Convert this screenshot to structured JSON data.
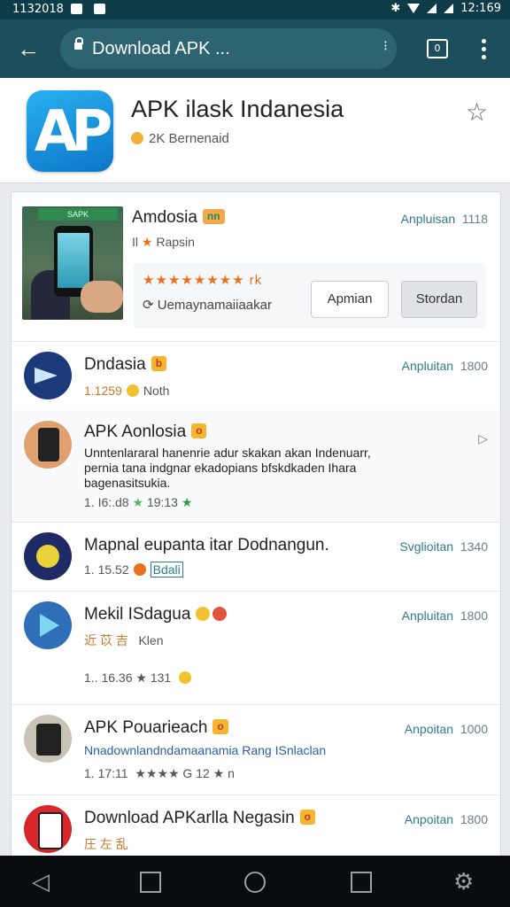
{
  "status_bar": {
    "time_left": "1132018",
    "time_right": "12:169"
  },
  "browser": {
    "url_text": "Download APK ...",
    "url_more": "⁝",
    "tab_count": "0"
  },
  "header": {
    "title": "APK ilask Indanesia",
    "subtitle": "2K Bernenaid",
    "logo_text": "AP"
  },
  "featured": {
    "banner": "SAPK",
    "name": "Amdosia",
    "badge": "nn",
    "action": "Anpluisan",
    "size": "1118",
    "meta_prefix": "Il",
    "meta": "Rapsin",
    "stars": "★★★★★★★★ rk",
    "promo": "Uemaynamaiiaakar",
    "button_primary": "Apmian",
    "button_secondary": "Stordan"
  },
  "list": [
    {
      "name": "Dndasia",
      "badge": "b",
      "action": "Anpluitan",
      "size": "1800",
      "meta_num": "1.1259",
      "meta_tag": "Noth"
    },
    {
      "name": "APK Aonlosia",
      "badge": "o",
      "desc": "Unntenlararal hanenrie adur skakan akan Indenuarr, pernia tana indgnar ekadopians bfskdkaden Ihara bagenasitsukia.",
      "meta_num": "1. I6:.d8",
      "meta_tag": "19:13"
    },
    {
      "name": "Mapnal eupanta itar Dodnangun.",
      "action": "Svglioitan",
      "size": "1340",
      "meta_num": "1. 15.52",
      "meta_tag": "Bdali"
    },
    {
      "name": "Mekil ISdagua",
      "action": "Anpluitan",
      "size": "1800",
      "meta_num": "近 苡 吉",
      "meta_tag": "Klen",
      "meta2": "1.. 16.36  ★ 131"
    },
    {
      "name": "APK Pouarieach",
      "badge": "o",
      "action": "Anpoitan",
      "size": "1000",
      "desc": "Nnadownlandndamaanamia Rang ISnlaclan",
      "meta_num": "1. 17:11",
      "meta_tag": "★★★★ G 12 ★ n"
    },
    {
      "name": "Download APKarlla Negasin",
      "badge": "o",
      "action": "Anpoitan",
      "size": "1800",
      "meta_num": "圧 左 乱"
    }
  ],
  "colors": {
    "accent": "#1d4e5b",
    "link": "#2f7b8e",
    "orange": "#e8701e"
  }
}
